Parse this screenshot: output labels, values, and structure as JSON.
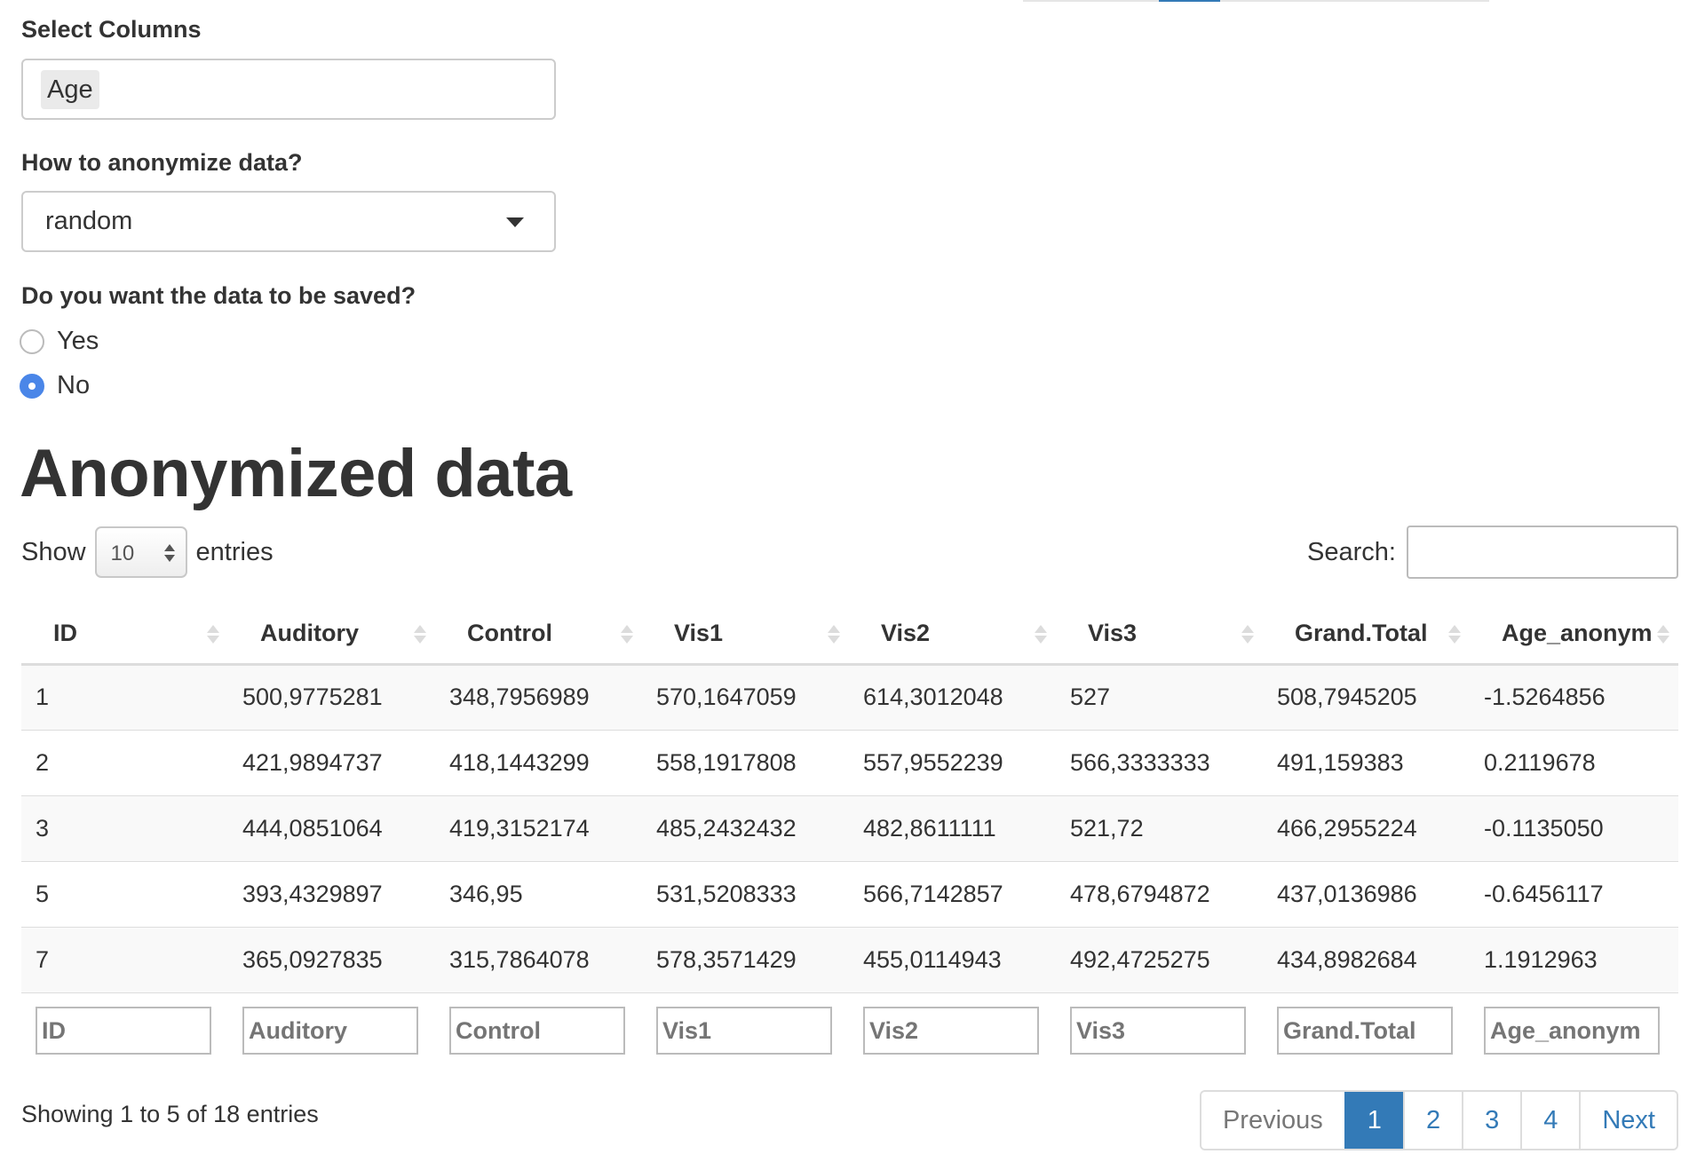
{
  "form": {
    "columns_label": "Select Columns",
    "columns_selected": "Age",
    "method_label": "How to anonymize data?",
    "method_value": "random",
    "save_label": "Do you want the data to be saved?",
    "save_options": [
      {
        "label": "Yes",
        "checked": false
      },
      {
        "label": "No",
        "checked": true
      }
    ]
  },
  "table_section": {
    "title": "Anonymized data",
    "show_label": "Show",
    "length_value": "10",
    "entries_label": "entries",
    "search_label": "Search:",
    "columns": [
      "ID",
      "Auditory",
      "Control",
      "Vis1",
      "Vis2",
      "Vis3",
      "Grand.Total",
      "Age_anonym"
    ],
    "rows": [
      [
        "1",
        "500,9775281",
        "348,7956989",
        "570,1647059",
        "614,3012048",
        "527",
        "508,7945205",
        "-1.5264856"
      ],
      [
        "2",
        "421,9894737",
        "418,1443299",
        "558,1917808",
        "557,9552239",
        "566,3333333",
        "491,159383",
        "0.2119678"
      ],
      [
        "3",
        "444,0851064",
        "419,3152174",
        "485,2432432",
        "482,8611111",
        "521,72",
        "466,2955224",
        "-0.1135050"
      ],
      [
        "5",
        "393,4329897",
        "346,95",
        "531,5208333",
        "566,7142857",
        "478,6794872",
        "437,0136986",
        "-0.6456117"
      ],
      [
        "7",
        "365,0927835",
        "315,7864078",
        "578,3571429",
        "455,0114943",
        "492,4725275",
        "434,8982684",
        "1.1912963"
      ]
    ],
    "info": "Showing 1 to 5 of 18 entries",
    "pagination": {
      "previous": "Previous",
      "pages": [
        "1",
        "2",
        "3",
        "4"
      ],
      "active": "1",
      "next": "Next"
    }
  }
}
